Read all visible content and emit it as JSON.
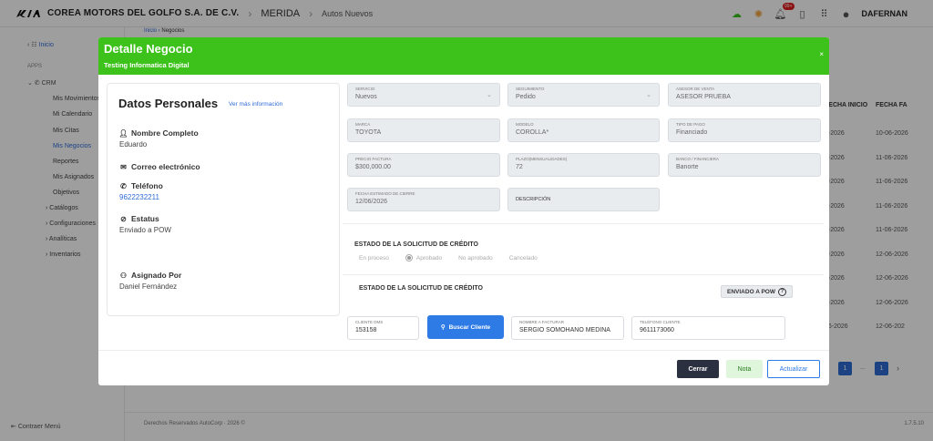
{
  "app": {
    "company": "COREA MOTORS DEL GOLFO S.A. DE C.V.",
    "city": "MERIDA",
    "section": "Autos Nuevos",
    "notification_count": "99+",
    "user": "DAFERNAN",
    "brand_color": "#3cc21b"
  },
  "breadcrumb": {
    "home": "Inicio",
    "current": "Negocios"
  },
  "sidebar": {
    "home": "Inicio",
    "apps_label": "APPS",
    "crm": "CRM",
    "items": [
      "Mis Movimientos",
      "Mi Calendario",
      "Mis Citas",
      "Mis Negocios",
      "Reportes",
      "Mis Asignados",
      "Objetivos"
    ],
    "groups": [
      "Catálogos",
      "Configuraciones",
      "Analíticas",
      "Inventarios"
    ],
    "collapse": "Contraer Menú"
  },
  "table": {
    "headers": [
      "FECHA INICIO",
      "FECHA FA"
    ],
    "rows": [
      [
        "8-2026",
        "10-06-2026"
      ],
      [
        "6-2026",
        "11-06-2026"
      ],
      [
        "6-2026",
        "11-06-2026"
      ],
      [
        "6-2026",
        "11-06-2026"
      ],
      [
        "6-2026",
        "11-06-2026"
      ],
      [
        "6-2026",
        "12-06-2026"
      ],
      [
        "6-2026",
        "12-06-2026"
      ],
      [
        "6-2026",
        "12-06-2026"
      ],
      [
        "06-2026",
        "12-06-202"
      ]
    ],
    "pages": [
      "1",
      "...",
      "1"
    ]
  },
  "footer": {
    "text": "Derechos Reservados AutoCorp · 2026 ©",
    "version": "1.7.5.10"
  },
  "modal": {
    "title": "Detalle Negocio",
    "subtitle": "Testing Informatica Digital",
    "close": "×",
    "personal": {
      "title": "Datos Personales",
      "more_link": "Ver más información",
      "name_label": "Nombre Completo",
      "name_value": "Eduardo",
      "email_label": "Correo electrónico",
      "email_value": "",
      "phone_label": "Teléfono",
      "phone_value": "9622232211",
      "status_label": "Estatus",
      "status_value": "Enviado a POW",
      "assigned_label": "Asignado Por",
      "assigned_value": "Daniel Fernández"
    },
    "fields": {
      "servicio": {
        "label": "Servicio",
        "value": "Nuevos"
      },
      "seguimiento": {
        "label": "Seguimiento",
        "value": "Pedido"
      },
      "asesor": {
        "label": "Asesor de venta",
        "value": "ASESOR PRUEBA"
      },
      "marca": {
        "label": "Marca",
        "value": "TOYOTA"
      },
      "modelo": {
        "label": "Modelo",
        "value": "COROLLA*"
      },
      "tipo_pago": {
        "label": "Tipo de pago",
        "value": "Financiado"
      },
      "precio": {
        "label": "Precio factura",
        "value": "$300,000.00"
      },
      "plazo": {
        "label": "Plazo(mensualidades)",
        "value": "72"
      },
      "banco": {
        "label": "Banco / Financiera",
        "value": "Banorte"
      },
      "fecha_cierre": {
        "label": "Fecha estimado de cierre",
        "value": "12/06/2026"
      },
      "descripcion": {
        "label": "Descripción"
      }
    },
    "credit_status": {
      "title": "ESTADO DE LA SOLICITUD DE CRÉDITO",
      "options": [
        "En proceso",
        "Aprobado",
        "No aprobado",
        "Cancelado"
      ],
      "selected": "Aprobado"
    },
    "credit_status2": {
      "title": "ESTADO DE LA SOLICITUD DE CRÉDITO",
      "chip": "ENVIADO A POW"
    },
    "client": {
      "id_label": "Cliente DMS",
      "id_value": "153158",
      "search_button": "Buscar Cliente",
      "invoice_label": "Nombre a facturar",
      "invoice_value": "SERGIO SOMOHANO MEDINA",
      "phone_label": "Teléfono cliente",
      "phone_value": "9611173060"
    },
    "buttons": {
      "close": "Cerrar",
      "note": "Nota",
      "update": "Actualizar"
    }
  }
}
